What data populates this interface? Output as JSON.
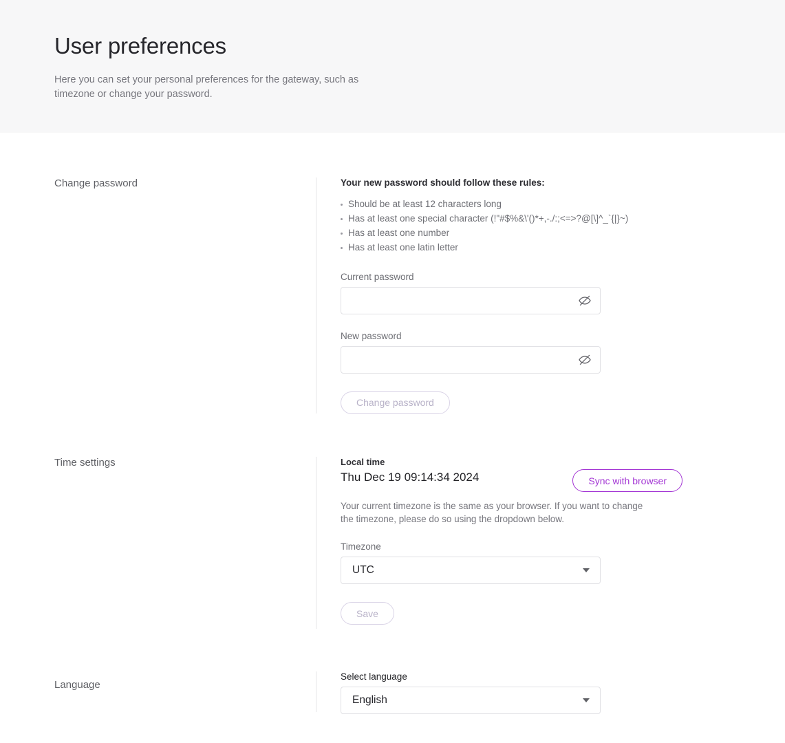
{
  "header": {
    "title": "User preferences",
    "subtitle": "Here you can set your personal preferences for the gateway, such as timezone or change your password."
  },
  "theme": {
    "accent": "#a335d4",
    "accent_disabled": "#b8b2c8",
    "header_bg": "#f7f7f8",
    "border": "#e0e0e4",
    "divider": "#e3e3e6",
    "text_primary": "#26262b",
    "text_muted": "#77777e"
  },
  "password_section": {
    "label": "Change password",
    "rules_heading": "Your new password should follow these rules:",
    "rules": [
      "Should be at least 12 characters long",
      "Has at least one special character (!\"#$%&\\'()*+,-./:;<=>?@[\\]^_`{|}~)",
      "Has at least one number",
      "Has at least one latin letter"
    ],
    "current_password": {
      "label": "Current password",
      "value": "",
      "placeholder": "",
      "toggle_icon": "eye-slash-icon"
    },
    "new_password": {
      "label": "New password",
      "value": "",
      "placeholder": "",
      "toggle_icon": "eye-slash-icon"
    },
    "submit_label": "Change password",
    "submit_disabled": true
  },
  "time_section": {
    "label": "Time settings",
    "local_time_label": "Local time",
    "local_time_value": "Thu Dec 19 09:14:34 2024",
    "sync_button_label": "Sync with browser",
    "note": "Your current timezone is the same as your browser. If you want to change the timezone, please do so using the dropdown below.",
    "timezone": {
      "label": "Timezone",
      "value": "UTC",
      "caret_icon": "chevron-down-icon"
    },
    "save_label": "Save",
    "save_disabled": true
  },
  "language_section": {
    "label": "Language",
    "select": {
      "label": "Select language",
      "value": "English",
      "caret_icon": "chevron-down-icon"
    }
  }
}
